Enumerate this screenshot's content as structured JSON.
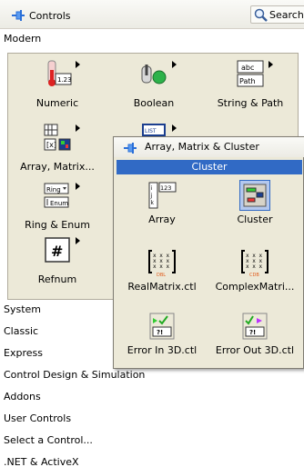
{
  "window": {
    "title": "Controls",
    "search_label": "Search"
  },
  "section": {
    "modern_label": "Modern"
  },
  "modern_tiles": [
    {
      "label": "Numeric"
    },
    {
      "label": "Boolean"
    },
    {
      "label": "String & Path"
    },
    {
      "label": "Array, Matrix..."
    },
    {
      "label": "Ring & Enum"
    },
    {
      "label": "Refnum"
    }
  ],
  "icon_text": {
    "numeric": "1.23",
    "string_abc": "abc",
    "string_path": "Path",
    "ring": "Ring",
    "enum": "Enum",
    "list": "LIST",
    "array_index": "123"
  },
  "categories": [
    {
      "label": "System"
    },
    {
      "label": "Classic"
    },
    {
      "label": "Express"
    },
    {
      "label": "Control Design & Simulation"
    },
    {
      "label": "Addons"
    },
    {
      "label": "User Controls"
    },
    {
      "label": "Select a Control..."
    },
    {
      "label": ".NET & ActiveX"
    }
  ],
  "popup": {
    "title": "Array, Matrix & Cluster",
    "highlight": "Cluster",
    "items": [
      {
        "label": "Array"
      },
      {
        "label": "Cluster"
      },
      {
        "label": "RealMatrix.ctl"
      },
      {
        "label": "ComplexMatri..."
      },
      {
        "label": "Error In 3D.ctl"
      },
      {
        "label": "Error Out 3D.ctl"
      }
    ]
  },
  "colors": {
    "selection": "#316ac5",
    "palette_bg": "#ece9d8"
  }
}
